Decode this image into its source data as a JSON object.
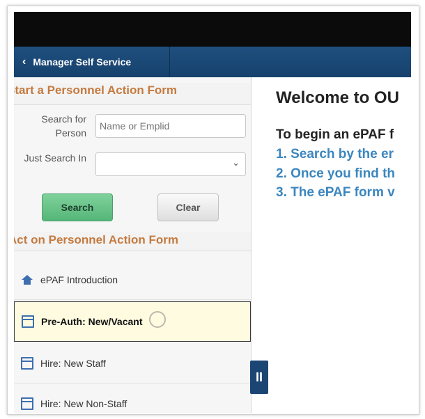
{
  "nav": {
    "back_label": "Manager Self Service"
  },
  "start_section": {
    "title": "Start a Personnel Action Form",
    "search_for_label": "Search for Person",
    "search_placeholder": "Name or Emplid",
    "just_search_label": "Just Search In",
    "just_search_value": "",
    "search_button": "Search",
    "clear_button": "Clear"
  },
  "act_section": {
    "title": "Act on Personnel Action Form",
    "items": [
      {
        "label": "ePAF Introduction",
        "icon": "home-icon"
      },
      {
        "label": "Pre-Auth: New/Vacant",
        "icon": "form-icon"
      },
      {
        "label": "Hire: New Staff",
        "icon": "form-icon"
      },
      {
        "label": "Hire: New Non-Staff",
        "icon": "form-add-icon"
      }
    ]
  },
  "collapse_glyph": "II",
  "main": {
    "welcome": "Welcome to OU",
    "begin": "To begin an ePAF f",
    "steps": [
      "1. Search by the er",
      "2. Once you find th",
      "3. The ePAF form v"
    ]
  },
  "colors": {
    "nav": "#1f4f7f",
    "section_title": "#c47a3f",
    "step_text": "#3b86bf",
    "search_btn": "#55b679"
  }
}
